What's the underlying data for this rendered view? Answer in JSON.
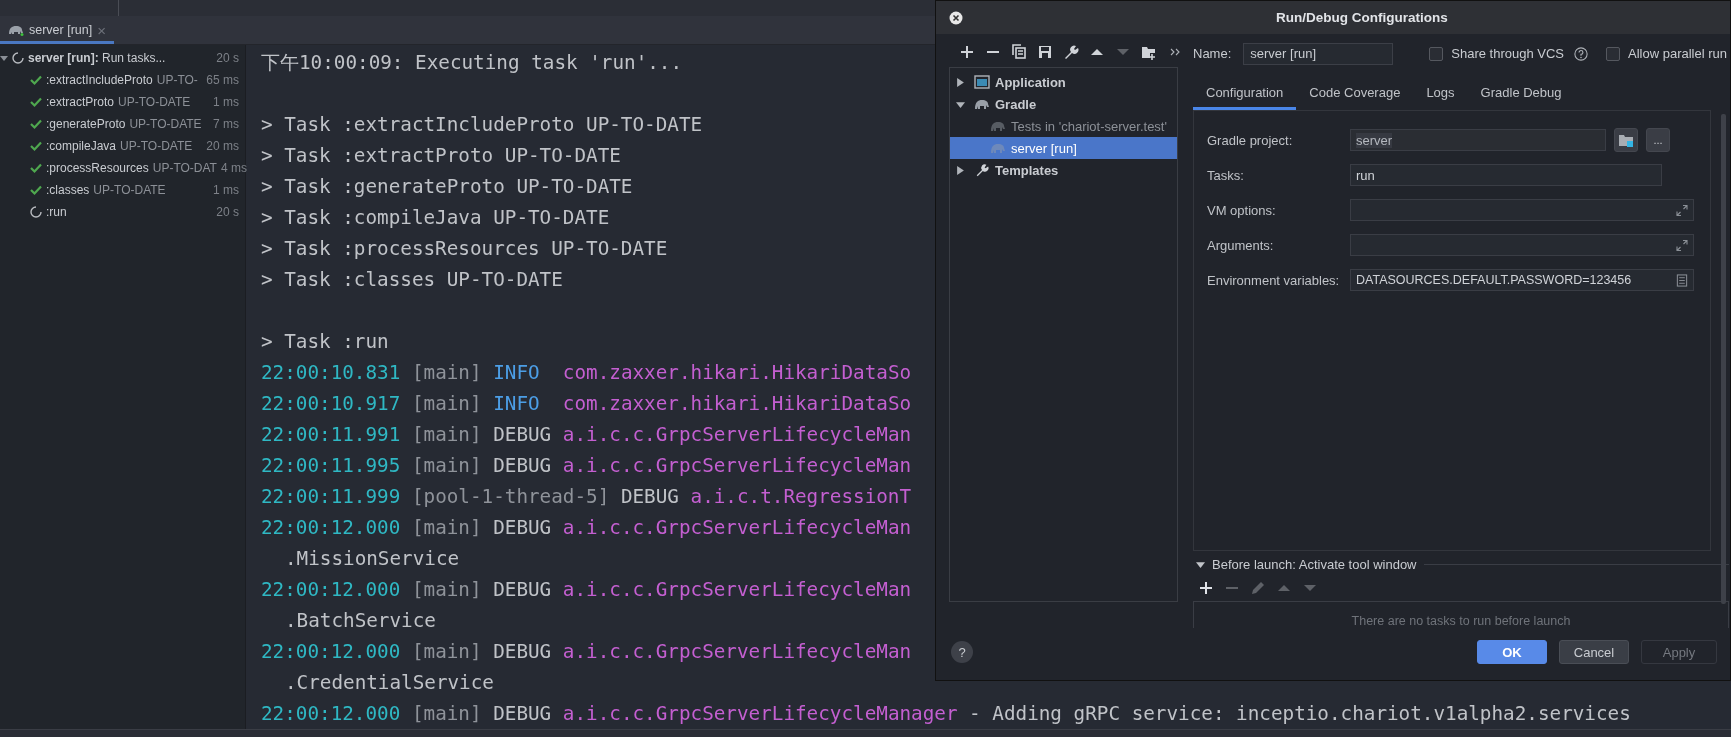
{
  "run_tab": {
    "label": "server [run]",
    "close": "×",
    "selected": true
  },
  "run_tree": {
    "label": "server [run]:",
    "detail": "Run tasks...",
    "time": "20 s",
    "kind": "running",
    "expanded": true,
    "children": [
      {
        "label": ":extractIncludeProto",
        "detail": "UP-TO-",
        "time": "65 ms",
        "kind": "done"
      },
      {
        "label": ":extractProto",
        "detail": "UP-TO-DATE",
        "time": "1 ms",
        "kind": "done"
      },
      {
        "label": ":generateProto",
        "detail": "UP-TO-DATE",
        "time": "7 ms",
        "kind": "done"
      },
      {
        "label": ":compileJava",
        "detail": "UP-TO-DATE",
        "time": "20 ms",
        "kind": "done"
      },
      {
        "label": ":processResources",
        "detail": "UP-TO-DAT",
        "time": "4 ms",
        "kind": "done"
      },
      {
        "label": ":classes",
        "detail": "UP-TO-DATE",
        "time": "1 ms",
        "kind": "done"
      },
      {
        "label": ":run",
        "time": "20 s",
        "kind": "running"
      }
    ]
  },
  "console": [
    {
      "kind": "text",
      "text": "下午10:00:09: Executing task 'run'..."
    },
    {
      "kind": "blank"
    },
    {
      "kind": "text",
      "text": "> Task :extractIncludeProto UP-TO-DATE"
    },
    {
      "kind": "text",
      "text": "> Task :extractProto UP-TO-DATE"
    },
    {
      "kind": "text",
      "text": "> Task :generateProto UP-TO-DATE"
    },
    {
      "kind": "text",
      "text": "> Task :compileJava UP-TO-DATE"
    },
    {
      "kind": "text",
      "text": "> Task :processResources UP-TO-DATE"
    },
    {
      "kind": "text",
      "text": "> Task :classes UP-TO-DATE"
    },
    {
      "kind": "blank"
    },
    {
      "kind": "text",
      "text": "> Task :run"
    },
    {
      "kind": "log",
      "time": "22:00:10.831",
      "thread": "[main]",
      "level": "INFO ",
      "color": "#4c9ee6",
      "logger": "com.zaxxer.hikari.HikariDataSo"
    },
    {
      "kind": "log",
      "time": "22:00:10.917",
      "thread": "[main]",
      "level": "INFO ",
      "color": "#4c9ee6",
      "logger": "com.zaxxer.hikari.HikariDataSo"
    },
    {
      "kind": "log",
      "time": "22:00:11.991",
      "thread": "[main]",
      "level": "DEBUG",
      "color": "#c0c3c8",
      "logger": "a.i.c.c.GrpcServerLifecycleMan"
    },
    {
      "kind": "log",
      "time": "22:00:11.995",
      "thread": "[main]",
      "level": "DEBUG",
      "color": "#c0c3c8",
      "logger": "a.i.c.c.GrpcServerLifecycleMan"
    },
    {
      "kind": "log",
      "time": "22:00:11.999",
      "thread": "[pool-1-thread-5]",
      "level": "DEBUG",
      "color": "#c0c3c8",
      "logger": "a.i.c.t.RegressionT"
    },
    {
      "kind": "log",
      "time": "22:00:12.000",
      "thread": "[main]",
      "level": "DEBUG",
      "color": "#c0c3c8",
      "logger": "a.i.c.c.GrpcServerLifecycleMan"
    },
    {
      "kind": "cont",
      "text": ".MissionService"
    },
    {
      "kind": "log",
      "time": "22:00:12.000",
      "thread": "[main]",
      "level": "DEBUG",
      "color": "#c0c3c8",
      "logger": "a.i.c.c.GrpcServerLifecycleMan"
    },
    {
      "kind": "cont",
      "text": ".BatchService"
    },
    {
      "kind": "log",
      "time": "22:00:12.000",
      "thread": "[main]",
      "level": "DEBUG",
      "color": "#c0c3c8",
      "logger": "a.i.c.c.GrpcServerLifecycleMan"
    },
    {
      "kind": "cont",
      "text": ".CredentialService"
    },
    {
      "kind": "log",
      "time": "22:00:12.000",
      "thread": "[main]",
      "level": "DEBUG",
      "color": "#c0c3c8",
      "logger": "a.i.c.c.GrpcServerLifecycleManager",
      "message": "- Adding gRPC service: inceptio.chariot.v1alpha2.services"
    }
  ],
  "dialog": {
    "title": "Run/Debug Configurations",
    "toolbar": [
      {
        "kind": "plus",
        "disabled": false
      },
      {
        "kind": "minus",
        "disabled": false
      },
      {
        "kind": "copy",
        "disabled": false
      },
      {
        "kind": "save",
        "disabled": false
      },
      {
        "kind": "wrench",
        "disabled": false
      },
      {
        "kind": "up",
        "disabled": false
      },
      {
        "kind": "down",
        "disabled": true
      },
      {
        "kind": "folder",
        "disabled": false
      },
      {
        "kind": "more",
        "disabled": false
      }
    ],
    "tree": [
      {
        "label": "Application",
        "kind": "application",
        "expanded": false,
        "selected": false
      },
      {
        "label": "Gradle",
        "kind": "gradle",
        "expanded": true,
        "selected": false,
        "children": [
          {
            "label": "Tests in 'chariot-server.test'",
            "kind": "gradle",
            "temporary": true,
            "selected": false
          },
          {
            "label": "server [run]",
            "kind": "gradle",
            "temporary": true,
            "selected": true
          }
        ]
      },
      {
        "label": "Templates",
        "kind": "wrench",
        "expanded": false,
        "selected": false
      }
    ],
    "name": {
      "label": "Name:",
      "value": "server [run]"
    },
    "options": [
      {
        "label": "Share through VCS",
        "checked": false,
        "help": true
      },
      {
        "label": "Allow parallel run",
        "checked": false,
        "help": false
      }
    ],
    "tabs": [
      {
        "label": "Configuration",
        "selected": true
      },
      {
        "label": "Code Coverage",
        "selected": false
      },
      {
        "label": "Logs",
        "selected": false
      },
      {
        "label": "Gradle Debug",
        "selected": false
      }
    ],
    "fields": [
      {
        "label": "Gradle project:",
        "value": "server",
        "kind": "project",
        "more": "..."
      },
      {
        "label": "Tasks:",
        "value": "run",
        "kind": "text"
      },
      {
        "label": "VM options:",
        "kind": "expand"
      },
      {
        "label": "Arguments:",
        "kind": "expand"
      },
      {
        "label": "Environment variables:",
        "value": "DATASOURCES.DEFAULT.PASSWORD=123456",
        "kind": "env"
      }
    ],
    "before_launch": {
      "label": "Before launch: Activate tool window",
      "expanded": true,
      "toolbar": [
        {
          "kind": "plus",
          "disabled": false
        },
        {
          "kind": "minus",
          "disabled": true
        },
        {
          "kind": "edit",
          "disabled": true
        },
        {
          "kind": "up",
          "disabled": true
        },
        {
          "kind": "down",
          "disabled": true
        }
      ],
      "empty_text": "There are no tasks to run before launch"
    },
    "help": "?",
    "buttons": [
      {
        "label": "OK",
        "kind": "primary"
      },
      {
        "label": "Cancel",
        "kind": "normal"
      },
      {
        "label": "Apply",
        "kind": "disabled"
      }
    ]
  }
}
